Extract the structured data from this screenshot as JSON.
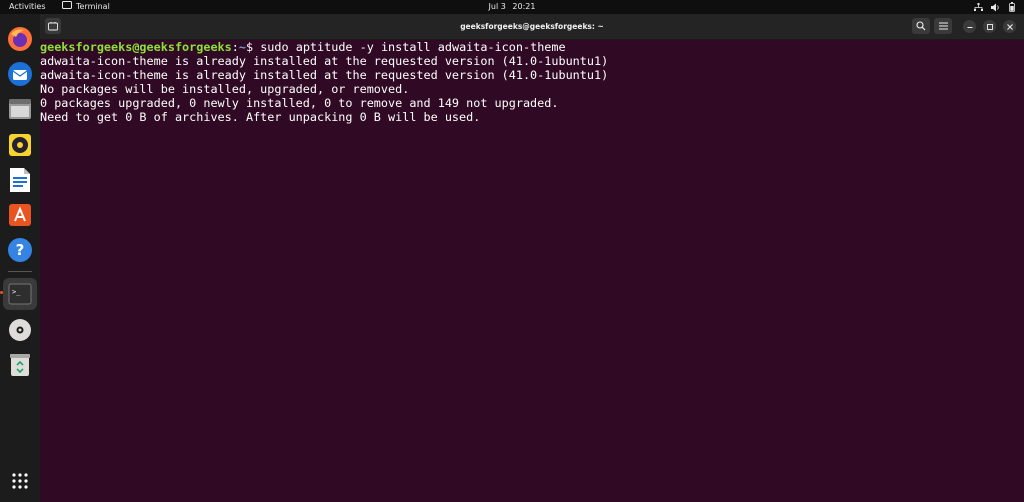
{
  "topbar": {
    "activities": "Activities",
    "app_name": "Terminal",
    "date": "Jul 3",
    "time": "20:21",
    "tray_icons": [
      "network-icon",
      "volume-icon",
      "battery-icon"
    ]
  },
  "dock": {
    "items": [
      {
        "name": "firefox",
        "icon": "firefox-icon"
      },
      {
        "name": "thunderbird",
        "icon": "thunderbird-icon"
      },
      {
        "name": "files",
        "icon": "files-icon"
      },
      {
        "name": "rhythmbox",
        "icon": "rhythmbox-icon"
      },
      {
        "name": "libreoffice-writer",
        "icon": "writer-icon"
      },
      {
        "name": "app-center",
        "icon": "app-center-icon"
      },
      {
        "name": "help",
        "icon": "help-icon",
        "glyph": "?"
      },
      {
        "name": "terminal",
        "icon": "terminal-icon",
        "glyph": ">_",
        "active": true
      },
      {
        "name": "disc",
        "icon": "disc-icon"
      },
      {
        "name": "trash",
        "icon": "trash-icon"
      }
    ],
    "show_apps_icon": "grid-icon"
  },
  "window": {
    "title": "geeksforgeeks@geeksforgeeks: ~",
    "buttons": [
      "search-icon",
      "menu-icon",
      "minimize-icon",
      "maximize-icon",
      "close-icon"
    ]
  },
  "terminal": {
    "prompt_user": "geeksforgeeks@geeksforgeeks",
    "prompt_colon": ":",
    "prompt_path": "~",
    "prompt_symbol": "$ ",
    "command": "sudo aptitude -y install adwaita-icon-theme",
    "output": [
      "adwaita-icon-theme is already installed at the requested version (41.0-1ubuntu1)",
      "adwaita-icon-theme is already installed at the requested version (41.0-1ubuntu1)",
      "No packages will be installed, upgraded, or removed.",
      "0 packages upgraded, 0 newly installed, 0 to remove and 149 not upgraded.",
      "Need to get 0 B of archives. After unpacking 0 B will be used."
    ]
  },
  "colors": {
    "terminal_bg": "#300a24",
    "prompt_user": "#8ae234",
    "prompt_path": "#729fcf",
    "dock_bg": "#1c1c1c",
    "topbar_bg": "#0f0f0f",
    "active_indicator": "#e95420"
  }
}
